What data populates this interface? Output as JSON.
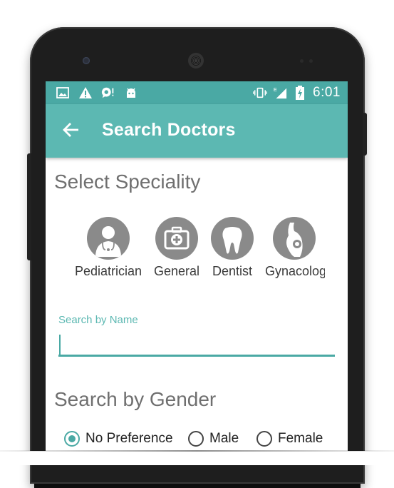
{
  "status_bar": {
    "time": "6:01",
    "icons_left": [
      "image-icon",
      "warning-icon",
      "chat-alert-icon",
      "android-icon"
    ],
    "icons_right": [
      "vibrate-icon",
      "signal-e-icon",
      "battery-charging-icon"
    ],
    "network_type": "E"
  },
  "app_bar": {
    "title": "Search Doctors",
    "back_icon": "arrow-left-icon",
    "color": "#5cb8b2"
  },
  "speciality": {
    "heading": "Select Speciality",
    "items": [
      {
        "label": "Pediatrician",
        "icon": "doctor-icon"
      },
      {
        "label": "General",
        "icon": "medical-kit-icon"
      },
      {
        "label": "Dentist",
        "icon": "tooth-icon"
      },
      {
        "label": "Gynacolog",
        "icon": "pregnancy-icon"
      }
    ]
  },
  "search_name": {
    "label": "Search by Name",
    "value": ""
  },
  "gender": {
    "heading": "Search by Gender",
    "options": [
      {
        "label": "No Preference",
        "selected": true
      },
      {
        "label": "Male",
        "selected": false
      },
      {
        "label": "Female",
        "selected": false
      }
    ]
  },
  "colors": {
    "accent": "#4aa9a4",
    "status_bar": "#4aa9a4",
    "icon_circle": "#8a8a8a"
  }
}
